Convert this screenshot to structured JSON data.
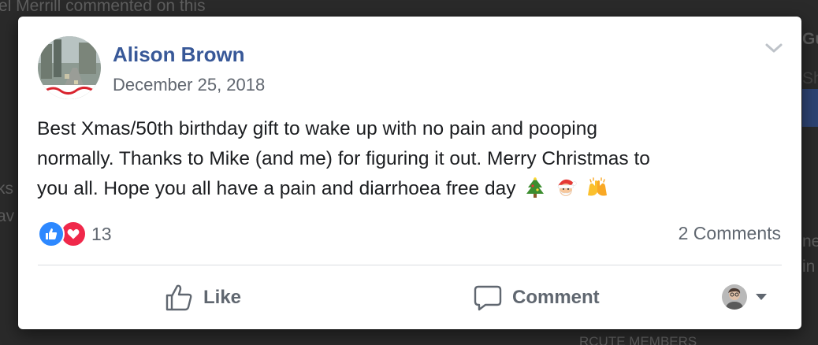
{
  "background": {
    "snippets": [
      "el Merrill commented on this",
      "Gu",
      "Sha",
      "ks",
      "av",
      "ne",
      "in",
      "RCUTE MEMBERS"
    ]
  },
  "post": {
    "author": "Alison Brown",
    "date": "December 25, 2018",
    "body_lines": [
      "Best Xmas/50th birthday gift to wake up with no pain and pooping",
      "normally. Thanks to Mike (and me) for figuring it out. Merry Christmas to",
      "you all. Hope you all have a pain and diarrhoea free day"
    ],
    "emojis": [
      "christmas-tree",
      "santa",
      "raising-hands"
    ],
    "reactions": {
      "types": [
        "like",
        "love"
      ],
      "count": "13"
    },
    "comments_count": "2 Comments"
  },
  "actions": {
    "like_label": "Like",
    "comment_label": "Comment"
  },
  "colors": {
    "author_link": "#385898",
    "like_blue": "#2d88ff",
    "love_red": "#f0284a",
    "secondary_text": "#606770"
  }
}
